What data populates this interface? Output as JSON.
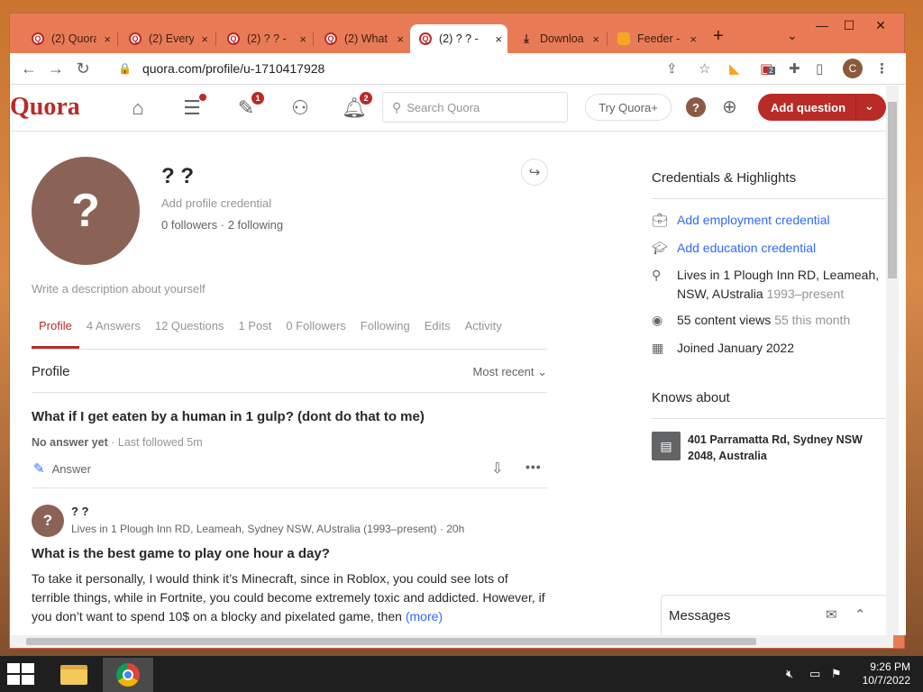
{
  "browser": {
    "tabs": [
      {
        "title": "(2) Quora",
        "favicon": "quora-icon"
      },
      {
        "title": "(2) Every",
        "favicon": "quora-icon"
      },
      {
        "title": "(2) ? ? -",
        "favicon": "quora-icon"
      },
      {
        "title": "(2) What",
        "favicon": "quora-icon"
      },
      {
        "title": "(2) ? ? -",
        "favicon": "quora-icon"
      },
      {
        "title": "Downloa",
        "favicon": "download-icon"
      },
      {
        "title": "Feeder -",
        "favicon": "rss-icon"
      }
    ],
    "close_glyph": "×",
    "new_tab": "+",
    "tab_menu": "⌄",
    "url": "quora.com/profile/u-1710417928",
    "ext_badge": "2",
    "profile_initial": "C",
    "window_controls": {
      "minimize": "—",
      "maximize": "☐",
      "close": "✕"
    }
  },
  "header": {
    "logo": "Quora",
    "notif_badge_answer": "1",
    "notif_badge_bell": "2",
    "search_placeholder": "Search Quora",
    "try_label": "Try Quora+",
    "help_glyph": "?",
    "add_question": "Add question"
  },
  "profile": {
    "avatar_glyph": "?",
    "name": "? ?",
    "credential_prompt": "Add profile credential",
    "follow_stats": "0 followers · 2 following",
    "description_prompt": "Write a description about yourself",
    "tabs": [
      "Profile",
      "4 Answers",
      "12 Questions",
      "1 Post",
      "0 Followers",
      "Following",
      "Edits",
      "Activity"
    ],
    "section_title": "Profile",
    "sort_label": "Most recent"
  },
  "feed": {
    "q1_title": "What if I get eaten by a human in 1 gulp? (dont do that to me)",
    "q1_status": "No answer yet",
    "q1_followed": " · Last followed 5m",
    "q1_answer_label": "Answer",
    "author_name": "? ?",
    "author_meta": "Lives in 1 Plough Inn RD, Leameah, Sydney NSW, AUstralia (1993–present) · 20h",
    "q2_title": "What is the best game to play one hour a day?",
    "q2_body": "To take it personally, I would think it’s Minecraft, since in Roblox, you could see lots of terrible things, while in Fortnite, you could become extremely toxic and addicted. However, if you don’t want to spend 10$ on a blocky and pixelated game, then",
    "q2_more": "(more)"
  },
  "sidebar": {
    "credentials_title": "Credentials & Highlights",
    "employment": "Add employment credential",
    "education": "Add education credential",
    "lives_in": "Lives in 1 Plough Inn RD, Leameah, NSW, AUstralia",
    "lives_years": "1993–present",
    "views": "55 content views",
    "views_month": "55 this month",
    "joined": "Joined January 2022",
    "knows_title": "Knows about",
    "knows_item": "401 Parramatta Rd, Sydney NSW 2048, Australia",
    "messages": "Messages"
  },
  "taskbar": {
    "time": "9:26 PM",
    "date": "10/7/2022"
  }
}
